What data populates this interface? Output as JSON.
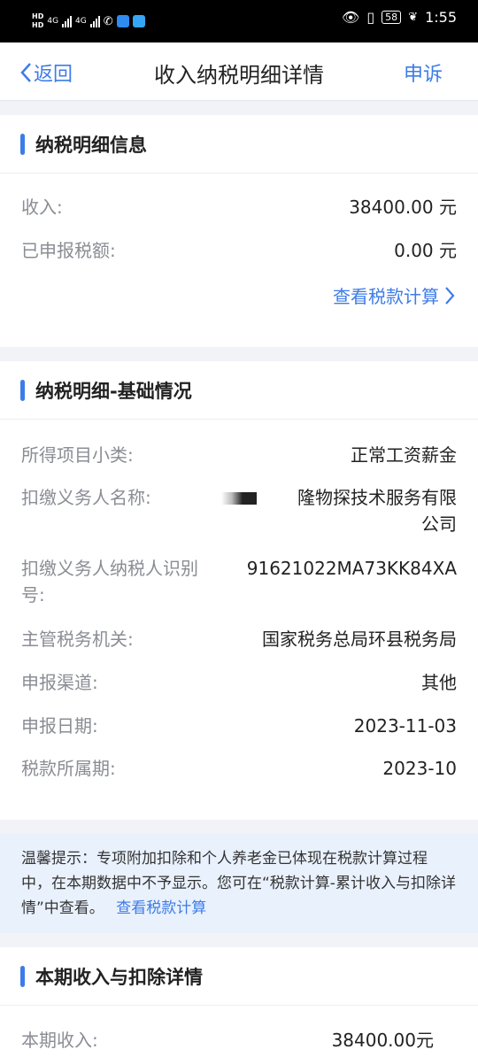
{
  "status_bar": {
    "hd_top": "HD",
    "hd_bottom": "HD",
    "net1": "4G",
    "net2": "4G",
    "battery": "58",
    "time": "1:55"
  },
  "nav": {
    "back_label": "返回",
    "title": "收入纳税明细详情",
    "appeal_label": "申诉"
  },
  "tax_info": {
    "title": "纳税明细信息",
    "income_label": "收入:",
    "income_value": "38400.00 元",
    "declared_label": "已申报税额:",
    "declared_value": "0.00 元",
    "view_calc": "查看税款计算"
  },
  "basic": {
    "title": "纳税明细-基础情况",
    "category_label": "所得项目小类:",
    "category_value": "正常工资薪金",
    "withholder_label": "扣缴义务人名称:",
    "withholder_value_line1": "　　　隆物探技术服务有限",
    "withholder_value_line2": "公司",
    "taxid_label_line1": "扣缴义务人纳税人识别",
    "taxid_label_line2": "号:",
    "taxid_value": "91621022MA73KK84XA",
    "authority_label": "主管税务机关:",
    "authority_value": "国家税务总局环县税务局",
    "channel_label": "申报渠道:",
    "channel_value": "其他",
    "date_label": "申报日期:",
    "date_value": "2023-11-03",
    "period_label": "税款所属期:",
    "period_value": "2023-10"
  },
  "tip": {
    "text": "温馨提示：专项附加扣除和个人养老金已体现在税款计算过程中，在本期数据中不予显示。您可在“税款计算-累计收入与扣除详情”中查看。",
    "link": "查看税款计算"
  },
  "current": {
    "title": "本期收入与扣除详情",
    "income_label": "本期收入:",
    "income_value": "38400.00元"
  },
  "colors": {
    "accent": "#3d7ce8",
    "tip_bg": "#e9f1fd"
  }
}
